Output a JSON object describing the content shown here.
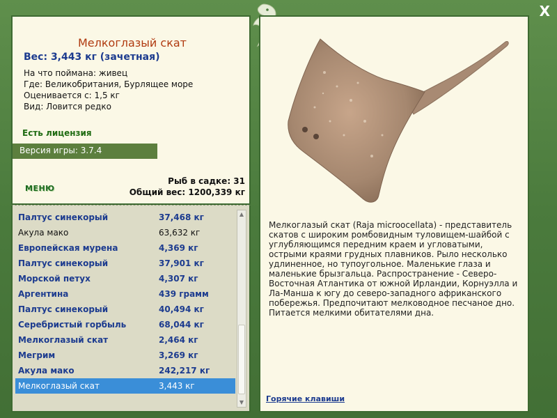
{
  "window": {
    "close_glyph": "X"
  },
  "fish": {
    "title": "Мелкоглазый скат",
    "weight_line": "Вес: 3,443 кг (зачетная)",
    "bait": "На что поймана: живец",
    "where": "Где: Великобритания, Бурлящее море",
    "rated_from": "Оценивается с: 1,5 кг",
    "kind": "Вид: Ловится редко"
  },
  "license": "Есть лицензия",
  "version": "Версия игры: 3.7.4",
  "menu_label": "МЕНЮ",
  "stats": {
    "fish_in_net": "Рыб в садке: 31",
    "total_weight": "Общий вес: 1200,339 кг"
  },
  "catch_list": [
    {
      "name": "Палтус синекорый",
      "weight": "37,468 кг",
      "style": "bold"
    },
    {
      "name": "Акула мако",
      "weight": "63,632 кг",
      "style": "plain"
    },
    {
      "name": "Европейская мурена",
      "weight": "4,369 кг",
      "style": "bold"
    },
    {
      "name": "Палтус синекорый",
      "weight": "37,901 кг",
      "style": "bold"
    },
    {
      "name": "Морской петух",
      "weight": "4,307 кг",
      "style": "bold"
    },
    {
      "name": "Аргентина",
      "weight": "439 грамм",
      "style": "bold"
    },
    {
      "name": "Палтус синекорый",
      "weight": "40,494 кг",
      "style": "bold"
    },
    {
      "name": "Серебристый горбыль",
      "weight": "68,044 кг",
      "style": "bold"
    },
    {
      "name": "Мелкоглазый скат",
      "weight": "2,464 кг",
      "style": "bold"
    },
    {
      "name": "Мегрим",
      "weight": "3,269 кг",
      "style": "bold"
    },
    {
      "name": "Акула мако",
      "weight": "242,217 кг",
      "style": "bold"
    },
    {
      "name": "Мелкоглазый скат",
      "weight": "3,443 кг",
      "style": "sel"
    }
  ],
  "description": "Мелкоглазый скат (Raja microocellata) - представитель скатов с широким ромбовидным туловищем-шайбой с углубляющимся передним краем и угловатыми, острыми краями грудных плавников. Рыло несколько удлиненное, но тупоугольное. Маленькие глаза и маленькие брызгальца. Распространение - Северо-Восточная Атлантика от южной Ирландии, Корнуэлла и Ла-Манша к югу до северо-западного африканского побережья. Предпочитают мелководное песчаное дно. Питается мелкими обитателями дна.",
  "hotkeys": "Горячие клавиши",
  "icons": {
    "close": "close-icon",
    "emblem": "fish-emblem-icon",
    "scroll_up": "scroll-up-icon",
    "scroll_down": "scroll-down-icon"
  },
  "colors": {
    "frame": "#4a7a3c",
    "selected_row": "#3a8ed8",
    "title": "#b03a10",
    "link": "#1c3b8f"
  }
}
